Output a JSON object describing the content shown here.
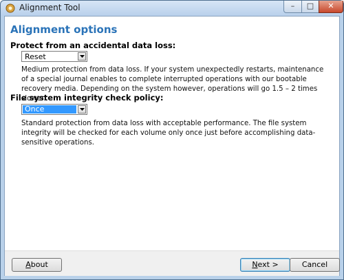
{
  "window": {
    "title": "Alignment Tool"
  },
  "titlebar": {
    "minimize_glyph": "–",
    "maximize_glyph": "□",
    "close_glyph": "✕"
  },
  "page": {
    "heading": "Alignment options",
    "protect": {
      "label": "Protect from an accidental data loss:",
      "selected": "Reset",
      "description": "Medium protection from data loss. If your system unexpectedly restarts, maintenance of a special journal enables to complete interrupted operations with our bootable recovery media. Depending on the system however, operations will go 1.5 – 2 times slower."
    },
    "integrity": {
      "label": "File system integrity check policy:",
      "selected": "Once",
      "description": "Standard protection from data loss with acceptable performance. The file system integrity will be checked for each volume only once just before accomplishing data-sensitive operations."
    }
  },
  "footer": {
    "about_first": "A",
    "about_rest": "bout",
    "next_first": "N",
    "next_rest": "ext >",
    "cancel_label": "Cancel"
  },
  "icons": {
    "app": "alignment-tool-icon",
    "dropdown": "chevron-down-icon"
  },
  "colors": {
    "heading": "#2a73b8",
    "selection": "#3399ff"
  }
}
